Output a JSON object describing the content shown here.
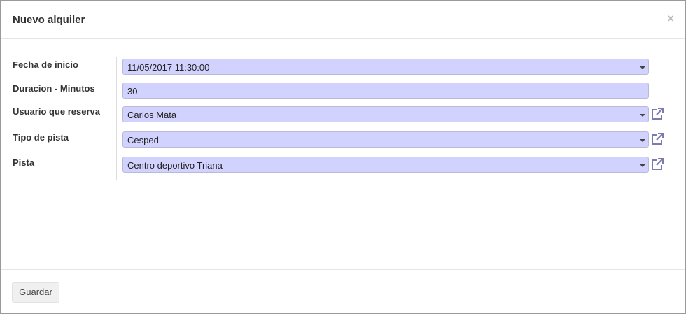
{
  "dialog": {
    "title": "Nuevo alquiler",
    "close_label": "×"
  },
  "form": {
    "fecha_label": "Fecha de inicio",
    "fecha_value": "11/05/2017 11:30:00",
    "duracion_label": "Duracion - Minutos",
    "duracion_value": "30",
    "usuario_label": "Usuario que reserva",
    "usuario_value": "Carlos Mata",
    "tipo_label": "Tipo de pista",
    "tipo_value": "Cesped",
    "pista_label": "Pista",
    "pista_value": "Centro deportivo Triana"
  },
  "footer": {
    "save_label": "Guardar"
  },
  "colors": {
    "field_bg": "#d2d2ff",
    "icon": "#7c7bad"
  },
  "icons": [
    "close-icon",
    "dropdown-caret-icon",
    "external-link-icon"
  ]
}
